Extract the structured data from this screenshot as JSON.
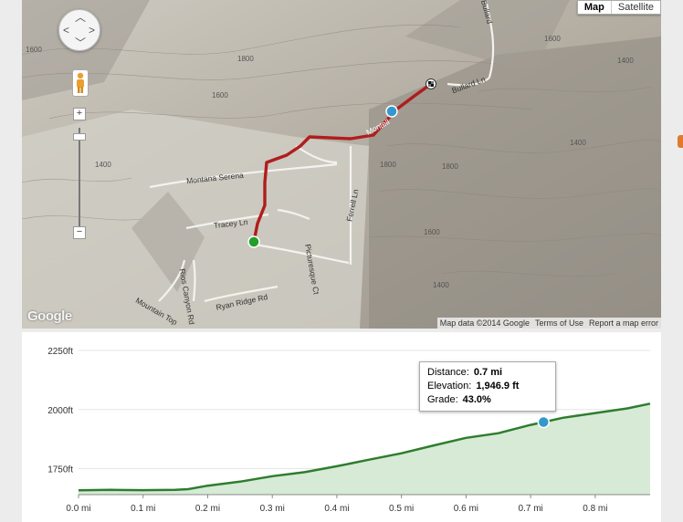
{
  "map": {
    "type_buttons": [
      "Map",
      "Satellite"
    ],
    "zoom_in": "+",
    "zoom_out": "−",
    "attribution": [
      "Map data ©2014 Google",
      "Terms of Use",
      "Report a map error"
    ],
    "logo": "Google",
    "roads": {
      "montana_serena": "Montana Serena",
      "tracey_ln": "Tracey Ln",
      "ferrell_ln": "Ferrell Ln",
      "picturesque_ct": "Picturesque Ct",
      "ryan_ridge_rd": "Ryan Ridge Rd",
      "mountain_top": "Mountain Top",
      "rios_canyon_rd": "Rios Canyon Rd",
      "bullard_ln": "Bullard Ln",
      "bullard_top": "Bullard",
      "montell": "Montell"
    },
    "contours": [
      "1600",
      "1800",
      "1600",
      "1400",
      "1800",
      "1600",
      "1400",
      "1800",
      "1600",
      "1400",
      "1400"
    ]
  },
  "elevation": {
    "tooltip": {
      "distance_label": "Distance:",
      "distance_value": "0.7 mi",
      "elevation_label": "Elevation:",
      "elevation_value": "1,946.9 ft",
      "grade_label": "Grade:",
      "grade_value": "43.0%"
    },
    "line_color": "#2e7d2e",
    "fill_color": "#d6ead6",
    "marker_color": "#3399cc"
  },
  "chart_data": {
    "type": "area",
    "xlabel": "",
    "ylabel": "",
    "xlim": [
      0,
      0.885
    ],
    "ylim": [
      1640,
      2250
    ],
    "x_ticks": [
      "0.0 mi",
      "0.1 mi",
      "0.2 mi",
      "0.3 mi",
      "0.4 mi",
      "0.5 mi",
      "0.6 mi",
      "0.7 mi",
      "0.8 mi"
    ],
    "x_tick_values": [
      0,
      0.1,
      0.2,
      0.3,
      0.4,
      0.5,
      0.6,
      0.7,
      0.8
    ],
    "y_ticks": [
      "2250ft",
      "2000ft",
      "1750ft"
    ],
    "y_tick_values": [
      2250,
      2000,
      1750
    ],
    "x": [
      0,
      0.05,
      0.1,
      0.15,
      0.17,
      0.2,
      0.25,
      0.3,
      0.35,
      0.4,
      0.45,
      0.5,
      0.55,
      0.6,
      0.65,
      0.7,
      0.72,
      0.75,
      0.8,
      0.85,
      0.885
    ],
    "y": [
      1658,
      1660,
      1659,
      1660,
      1663,
      1678,
      1695,
      1718,
      1735,
      1760,
      1788,
      1815,
      1848,
      1880,
      1900,
      1935,
      1947,
      1965,
      1985,
      2005,
      2025
    ],
    "marker": {
      "x": 0.72,
      "y": 1946.9
    }
  }
}
